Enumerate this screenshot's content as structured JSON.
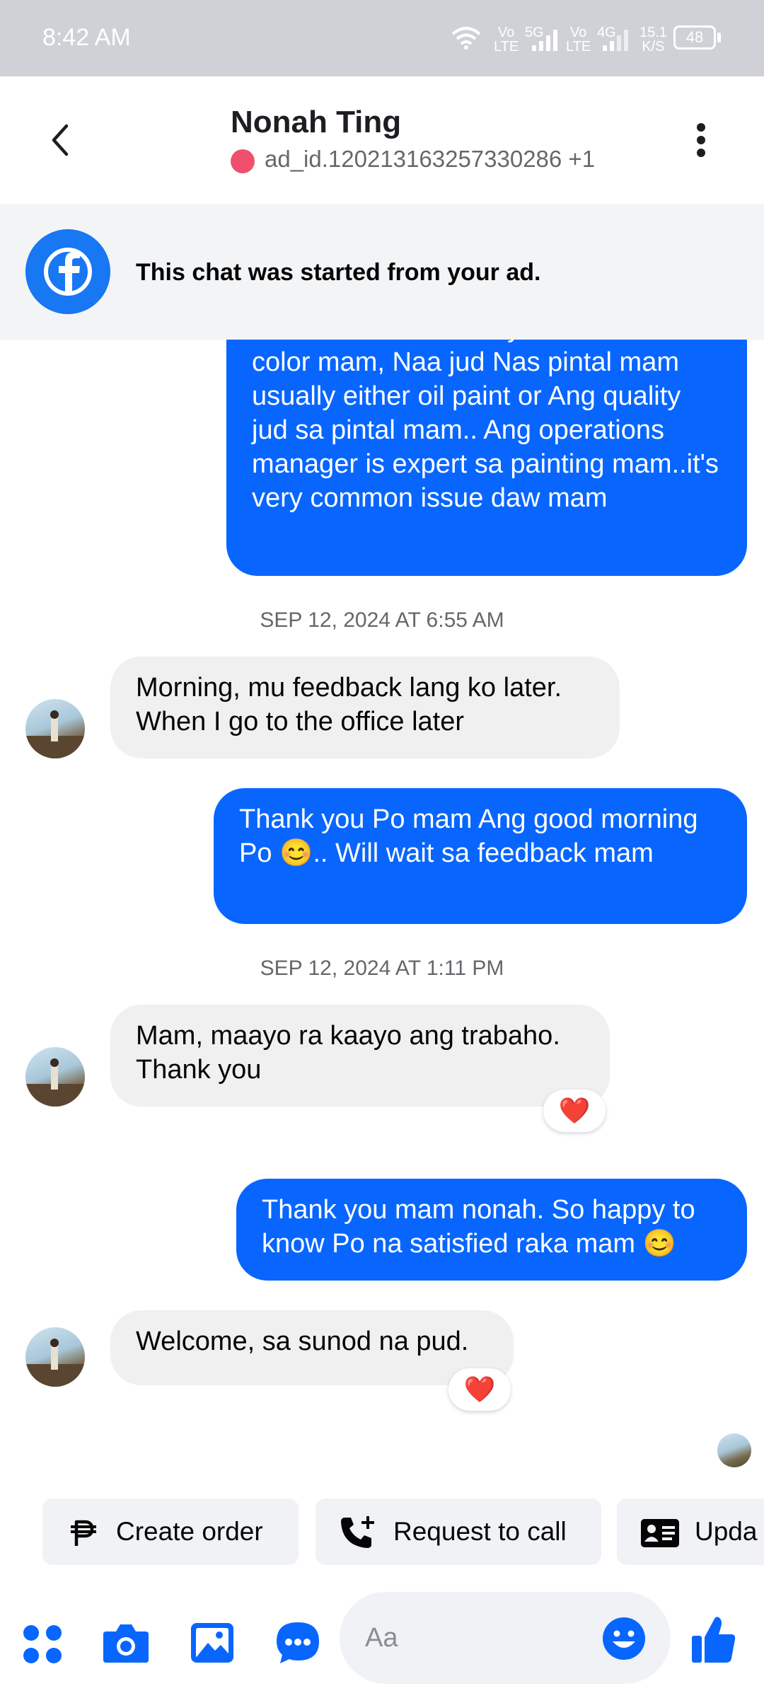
{
  "status_bar": {
    "time": "8:42 AM",
    "network1_top": "Vo",
    "network1_bottom": "LTE",
    "network1_type": "5G",
    "network2_top": "Vo",
    "network2_bottom": "LTE",
    "network2_type": "4G",
    "speed_top": "15.1",
    "speed_bottom": "K/S",
    "battery": "48",
    "icons": [
      "wifi-icon",
      "signal-icon",
      "battery-icon"
    ]
  },
  "header": {
    "title": "Nonah Ting",
    "subtitle": "ad_id.120213163257330286  +1",
    "back_icon": "chevron-left-icon",
    "menu_icon": "more-vertical-icon"
  },
  "banner": {
    "text": "This chat was started from your ad.",
    "icon": "facebook-icon"
  },
  "messages": [
    {
      "direction": "out",
      "text": "mao na mo discolor sya na brownish color mam, Naa jud Nas pintal mam usually either oil paint or Ang quality jud sa pintal mam.. Ang operations manager is expert sa painting mam..it's very common issue daw mam"
    },
    {
      "type": "timestamp",
      "text": "SEP 12, 2024 AT 6:55 AM"
    },
    {
      "direction": "in",
      "text": "Morning, mu feedback lang ko later. When I go to the office later"
    },
    {
      "direction": "out",
      "text": "Thank you Po mam Ang good morning Po 😊.. Will wait sa feedback mam"
    },
    {
      "type": "timestamp",
      "text": "SEP 12, 2024 AT 1:11 PM"
    },
    {
      "direction": "in",
      "text": "Mam, maayo ra kaayo ang trabaho. Thank you",
      "reaction": "❤️"
    },
    {
      "direction": "out",
      "text": "Thank you mam nonah. So happy to know Po na satisfied raka mam 😊"
    },
    {
      "direction": "in",
      "text": "Welcome, sa sunod na pud.",
      "reaction": "❤️"
    }
  ],
  "quick_actions": [
    {
      "label": "Create order",
      "icon": "peso-icon"
    },
    {
      "label": "Request to call",
      "icon": "phone-add-icon"
    },
    {
      "label": "Upda",
      "icon": "contact-card-icon"
    }
  ],
  "composer": {
    "placeholder": "Aa",
    "icons": [
      "apps-icon",
      "camera-icon",
      "gallery-icon",
      "chat-bubble-icon",
      "emoji-icon",
      "like-icon"
    ]
  },
  "colors": {
    "accent": "#0866ff",
    "facebook_blue": "#1877f2",
    "status_dot": "#f0506e",
    "heart": "#e41e3f"
  }
}
